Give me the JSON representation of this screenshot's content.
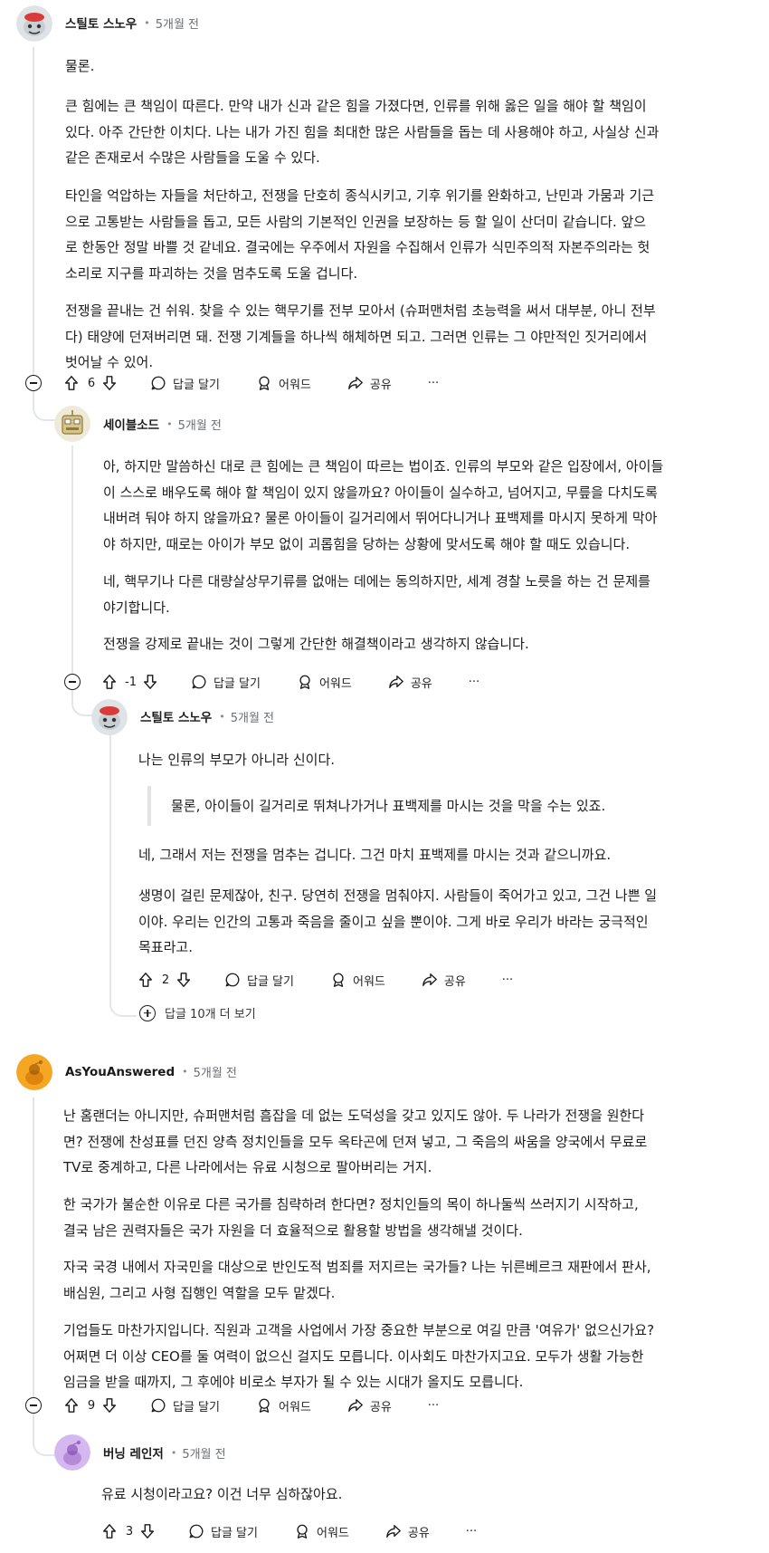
{
  "comments": [
    {
      "author": "스틸토 스노우",
      "time": "5개월 전",
      "paragraphs": [
        [
          "물론."
        ],
        [
          "큰 힘에는 큰 책임이 따른다. 만약 내가 신과 같은 힘을 가졌다면, 인류를 위해 옳은 일을 해야 할 책임이",
          "있다. 아주 간단한 이치다. 나는 내가 가진 힘을 최대한 많은 사람들을 돕는 데 사용해야 하고, 사실상 신과",
          "같은 존재로서 수많은 사람들을 도울 수 있다."
        ],
        [
          "타인을 억압하는 자들을 처단하고, 전쟁을 단호히 종식시키고, 기후 위기를 완화하고, 난민과 가뭄과 기근",
          "으로 고통받는 사람들을 돕고, 모든 사람의 기본적인 인권을 보장하는 등 할 일이 산더미 같습니다. 앞으",
          "로 한동안 정말 바쁠 것 같네요. 결국에는 우주에서 자원을 수집해서 인류가 식민주의적 자본주의라는 헛",
          "소리로 지구를 파괴하는 것을 멈추도록 도울 겁니다."
        ],
        [
          "전쟁을 끝내는 건 쉬워. 찾을 수 있는 핵무기를 전부 모아서 (슈퍼맨처럼 초능력을 써서 대부분, 아니 전부",
          "다) 태양에 던져버리면 돼. 전쟁 기계들을 하나씩 해체하면 되고. 그러면 인류는 그 야만적인 짓거리에서",
          "벗어날 수 있어."
        ]
      ],
      "score": "6"
    },
    {
      "author": "세이블소드",
      "time": "5개월 전",
      "paragraphs": [
        [
          "아, 하지만 말씀하신 대로 큰 힘에는 큰 책임이 따르는 법이죠. 인류의 부모와 같은 입장에서, 아이들",
          "이 스스로 배우도록 해야 할 책임이 있지 않을까요? 아이들이 실수하고, 넘어지고, 무릎을 다치도록",
          "내버려 둬야 하지 않을까요? 물론 아이들이 길거리에서 뛰어다니거나 표백제를 마시지 못하게 막아",
          "야 하지만, 때로는 아이가 부모 없이 괴롭힘을 당하는 상황에 맞서도록 해야 할 때도 있습니다."
        ],
        [
          "네, 핵무기나 다른 대량살상무기류를 없애는 데에는 동의하지만, 세계 경찰 노릇을 하는 건 문제를",
          "야기합니다."
        ],
        [
          "전쟁을 강제로 끝내는 것이 그렇게 간단한 해결책이라고 생각하지 않습니다."
        ]
      ],
      "score": "-1"
    },
    {
      "author": "스틸토 스노우",
      "time": "5개월 전",
      "paragraphs": [
        [
          "나는 인류의 부모가 아니라 신이다."
        ],
        [
          "네, 그래서 저는 전쟁을 멈추는 겁니다. 그건 마치 표백제를 마시는 것과 같으니까요."
        ],
        [
          "생명이 걸린 문제잖아, 친구. 당연히 전쟁을 멈춰야지. 사람들이 죽어가고 있고, 그건 나쁜 일",
          "이야. 우리는 인간의 고통과 죽음을 줄이고 싶을 뿐이야. 그게 바로 우리가 바라는 궁극적인",
          "목표라고."
        ]
      ],
      "quote": "물론, 아이들이 길거리로 뛰쳐나가거나 표백제를 마시는 것을 막을 수는 있죠.",
      "score": "2",
      "more_replies": "답글 10개 더 보기"
    },
    {
      "author": "AsYouAnswered",
      "time": "5개월 전",
      "paragraphs": [
        [
          "난 홈랜더는 아니지만, 슈퍼맨처럼 흠잡을 데 없는 도덕성을 갖고 있지도 않아. 두 나라가 전쟁을 원한다",
          "면? 전쟁에 찬성표를 던진 양측 정치인들을 모두 옥타곤에 던져 넣고, 그 죽음의 싸움을 양국에서 무료로",
          "TV로 중계하고, 다른 나라에서는 유료 시청으로 팔아버리는 거지."
        ],
        [
          "한 국가가 불순한 이유로 다른 국가를 침략하려 한다면? 정치인들의 목이 하나둘씩 쓰러지기 시작하고,",
          "결국 남은 권력자들은 국가 자원을 더 효율적으로 활용할 방법을 생각해낼 것이다."
        ],
        [
          "자국 국경 내에서 자국민을 대상으로 반인도적 범죄를 저지르는 국가들? 나는 뉘른베르크 재판에서 판사,",
          "배심원, 그리고 사형 집행인 역할을 모두 맡겠다."
        ],
        [
          "기업들도 마찬가지입니다. 직원과 고객을 사업에서 가장 중요한 부분으로 여길 만큼 '여유가' 없으신가요?",
          "어쩌면 더 이상 CEO를 둘 여력이 없으신 걸지도 모릅니다. 이사회도 마찬가지고요. 모두가 생활 가능한",
          "임금을 받을 때까지, 그 후에야 비로소 부자가 될 수 있는 시대가 올지도 모릅니다."
        ]
      ],
      "score": "9"
    },
    {
      "author": "버닝 레인저",
      "time": "5개월 전",
      "paragraphs": [
        [
          "유료 시청이라고요? 이건 너무 심하잖아요."
        ]
      ],
      "score": "3"
    }
  ],
  "actions": {
    "reply": "답글 달기",
    "award": "어워드",
    "share": "공유",
    "more": "···"
  }
}
